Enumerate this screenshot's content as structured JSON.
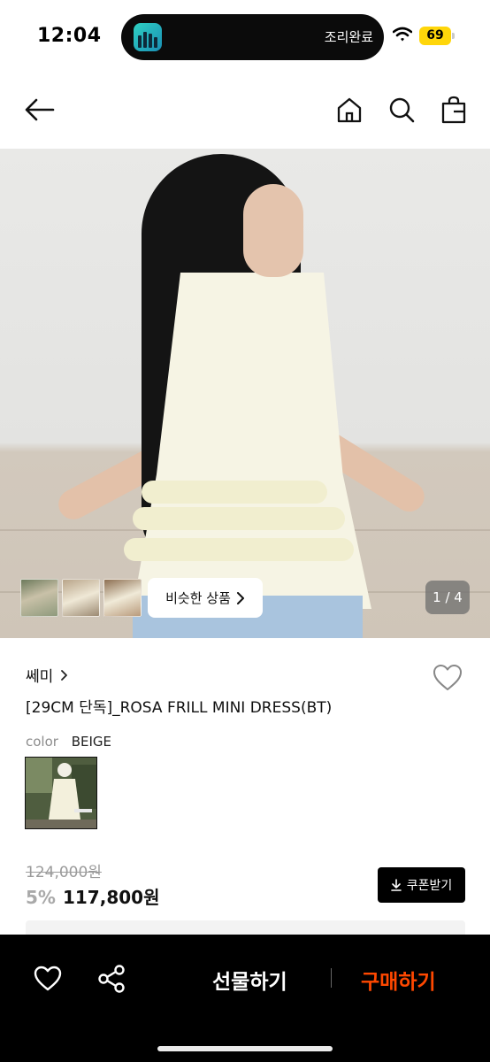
{
  "status_bar": {
    "time": "12:04",
    "island_text": "조리완료",
    "battery": "69",
    "icons": [
      "wifi-icon",
      "battery-icon"
    ]
  },
  "nav": {
    "icons": [
      "back-arrow-icon",
      "home-icon",
      "search-icon",
      "shopping-bag-icon"
    ]
  },
  "gallery": {
    "similar_button": "비슷한 상품",
    "page_counter": "1 / 4",
    "current_page": 1,
    "total_pages": 4
  },
  "product": {
    "brand": "쎄미",
    "title": "[29CM 단독]_ROSA FRILL MINI DRESS(BT)",
    "color_label": "color",
    "color_value": "BEIGE",
    "original_price": "124,000원",
    "discount": "5%",
    "price": "117,800원",
    "coupon_button": "쿠폰받기"
  },
  "bottom_bar": {
    "gift_button": "선물하기",
    "buy_button": "구매하기",
    "icons": [
      "heart-icon",
      "share-icon"
    ]
  },
  "colors": {
    "buy_accent": "#ff4800",
    "bottom_bar_bg": "#000000",
    "battery_badge": "#ffd60a"
  }
}
